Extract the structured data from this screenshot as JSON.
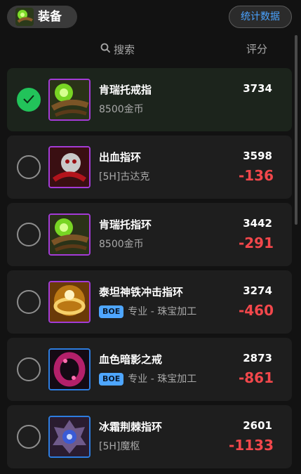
{
  "header": {
    "title": "装备",
    "stats_button": "统计数据",
    "search_label": "搜索",
    "score_label": "评分"
  },
  "items": [
    {
      "name": "肯瑞托戒指",
      "sub": "8500金币",
      "badge": "",
      "score": "3734",
      "diff": "",
      "selected": true,
      "icon": "green-gem-ring-icon",
      "frame": "#a33bd6"
    },
    {
      "name": "出血指环",
      "sub": "[5H]古达克",
      "badge": "",
      "score": "3598",
      "diff": "-136",
      "selected": false,
      "icon": "skull-ring-icon",
      "frame": "#a33bd6"
    },
    {
      "name": "肯瑞托指环",
      "sub": "8500金币",
      "badge": "",
      "score": "3442",
      "diff": "-291",
      "selected": false,
      "icon": "green-gem-ring-icon",
      "frame": "#a33bd6"
    },
    {
      "name": "泰坦神铁冲击指环",
      "sub": "专业 - 珠宝加工",
      "badge": "BOE",
      "score": "3274",
      "diff": "-460",
      "selected": false,
      "icon": "gold-glow-ring-icon",
      "frame": "#a33bd6"
    },
    {
      "name": "血色暗影之戒",
      "sub": "专业 - 珠宝加工",
      "badge": "BOE",
      "score": "2873",
      "diff": "-861",
      "selected": false,
      "icon": "crimson-ring-icon",
      "frame": "#2d7de0"
    },
    {
      "name": "冰霜荆棘指环",
      "sub": "[5H]魔枢",
      "badge": "",
      "score": "2601",
      "diff": "-1133",
      "selected": false,
      "icon": "frost-thorn-ring-icon",
      "frame": "#2d7de0"
    }
  ],
  "colors": {
    "accent_blue": "#4aa3ff",
    "check_green": "#22c35a",
    "diff_red": "#f2474b",
    "epic_frame": "#a33bd6",
    "rare_frame": "#2d7de0"
  }
}
